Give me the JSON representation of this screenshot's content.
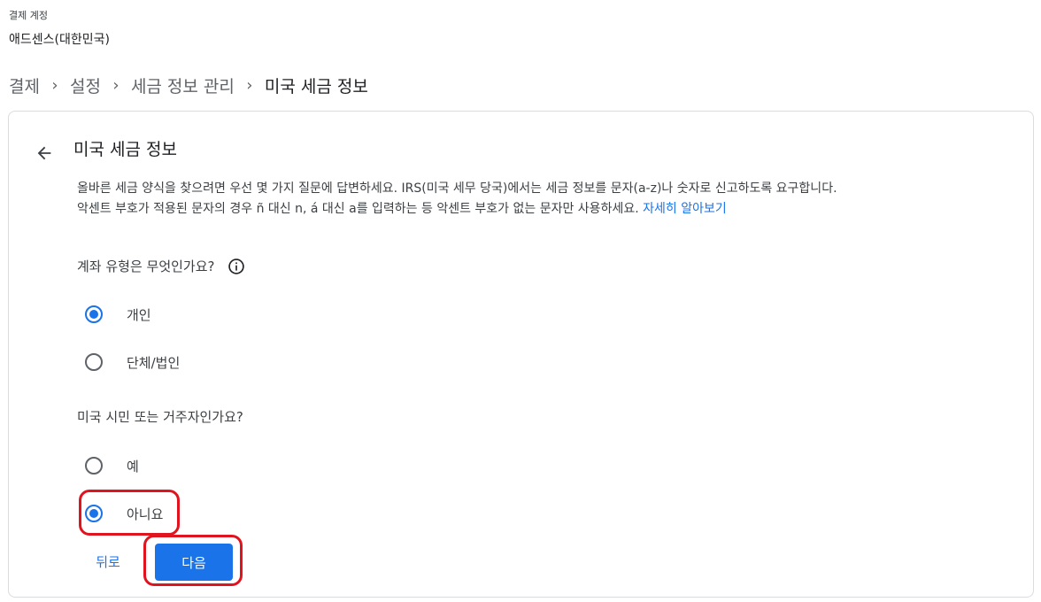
{
  "account": {
    "label": "결제 계정",
    "name": "애드센스(대한민국)"
  },
  "breadcrumb": {
    "items": [
      "결제",
      "설정",
      "세금 정보 관리",
      "미국 세금 정보"
    ],
    "separator": ">"
  },
  "card": {
    "title": "미국 세금 정보",
    "intro_line1": "올바른 세금 양식을 찾으려면 우선 몇 가지 질문에 답변하세요. IRS(미국 세무 당국)에서는 세금 정보를 문자(a-z)나 숫자로 신고하도록 요구합니다.",
    "intro_line2": "악센트 부호가 적용된 문자의 경우 ñ 대신 n, á 대신 a를 입력하는 등 악센트 부호가 없는 문자만 사용하세요.",
    "learn_more": "자세히 알아보기"
  },
  "q1": {
    "question": "계좌 유형은 무엇인가요?",
    "options": [
      {
        "label": "개인",
        "checked": true
      },
      {
        "label": "단체/법인",
        "checked": false
      }
    ]
  },
  "q2": {
    "question": "미국 시민 또는 거주자인가요?",
    "options": [
      {
        "label": "예",
        "checked": false
      },
      {
        "label": "아니요",
        "checked": true
      }
    ]
  },
  "actions": {
    "back_label": "뒤로",
    "next_label": "다음"
  },
  "colors": {
    "accent": "#1a73e8",
    "highlight": "#e0141e"
  },
  "icons": {
    "back": "arrow-left-icon",
    "info": "info-icon"
  }
}
